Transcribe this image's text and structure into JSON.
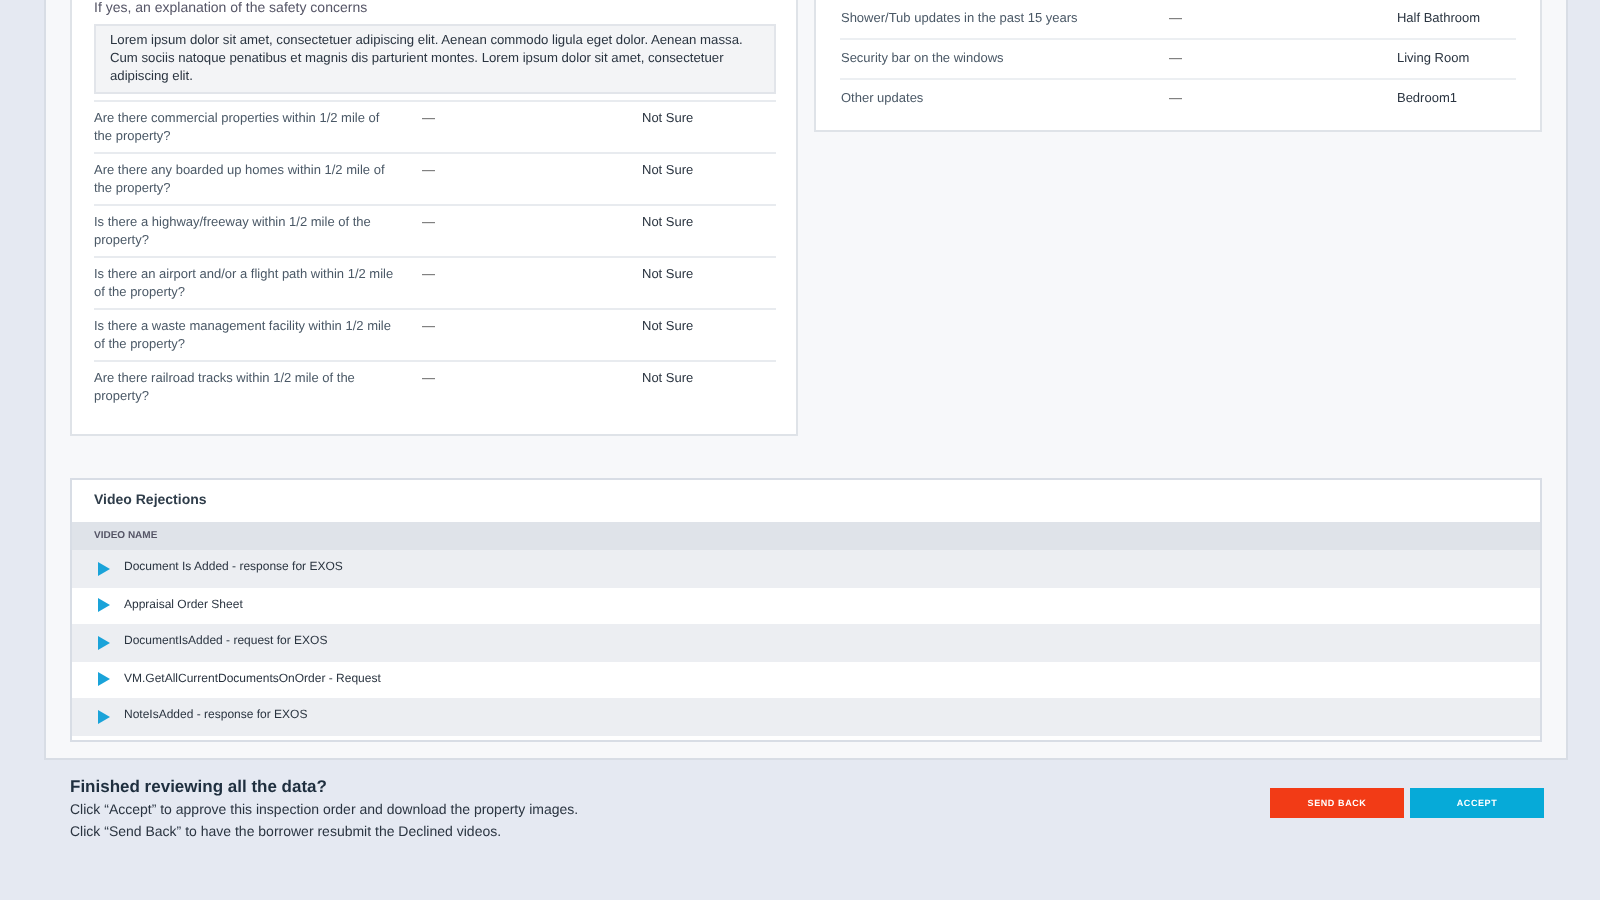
{
  "safety_explanation": {
    "label": "If yes, an explanation of the safety concerns",
    "text": "Lorem ipsum dolor sit amet, consectetuer adipiscing elit. Aenean commodo ligula eget dolor. Aenean massa. Cum sociis natoque penatibus et magnis dis parturient montes. Lorem ipsum dolor sit amet, consectetuer adipiscing elit."
  },
  "questions": [
    {
      "question": "Are there commercial properties within 1/2 mile of the property?",
      "note": "—",
      "answer": "Not Sure"
    },
    {
      "question": "Are there any boarded up homes within 1/2 mile of the property?",
      "note": "—",
      "answer": "Not Sure"
    },
    {
      "question": "Is there a highway/freeway within 1/2 mile of the property?",
      "note": "—",
      "answer": "Not Sure"
    },
    {
      "question": "Is there an airport and/or a flight path within 1/2 mile of the property?",
      "note": "—",
      "answer": "Not Sure"
    },
    {
      "question": "Is there a waste management facility within 1/2 mile of the property?",
      "note": "—",
      "answer": "Not Sure"
    },
    {
      "question": "Are there railroad tracks within 1/2 mile of the property?",
      "note": "—",
      "answer": "Not Sure"
    }
  ],
  "updates": [
    {
      "item": "Shower/Tub updates in the past 15 years",
      "note": "—",
      "room": "Half Bathroom"
    },
    {
      "item": "Security bar on the windows",
      "note": "—",
      "room": "Living Room"
    },
    {
      "item": "Other updates",
      "note": "—",
      "room": "Bedroom1"
    }
  ],
  "video_rejections": {
    "title": "Video Rejections",
    "column": "VIDEO NAME",
    "videos": [
      {
        "name": "Document Is Added - response for EXOS"
      },
      {
        "name": "Appraisal Order Sheet"
      },
      {
        "name": "DocumentIsAdded - request for EXOS"
      },
      {
        "name": "VM.GetAllCurrentDocumentsOnOrder - Request"
      },
      {
        "name": "NoteIsAdded - response for EXOS"
      }
    ]
  },
  "footer": {
    "heading": "Finished reviewing all the data?",
    "lines": [
      "Click “Accept” to approve this inspection order and download the property images.",
      "Click “Send Back” to have the borrower resubmit the Declined videos."
    ],
    "buttons": [
      {
        "label": "SEND BACK",
        "kind": "danger"
      },
      {
        "label": "ACCEPT",
        "kind": "primary"
      }
    ]
  }
}
